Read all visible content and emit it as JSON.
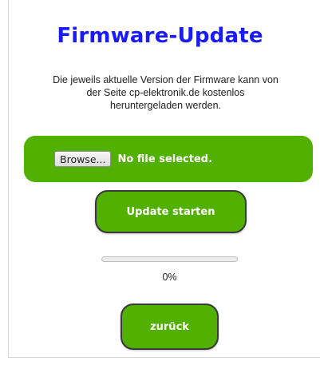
{
  "page": {
    "title": "Firmware-Update",
    "description_lines": [
      "Die jeweils aktuelle Version der Firmware kann von",
      "der Seite cp-elektronik.de kostenlos",
      "heruntergeladen werden."
    ]
  },
  "file_input": {
    "browse_label": "Browse...",
    "status_text": "No file selected."
  },
  "buttons": {
    "update_label": "Update starten",
    "back_label": "zurück"
  },
  "progress": {
    "value_percent": 0,
    "label": "0%"
  },
  "colors": {
    "title": "#1a1aff",
    "accent_green": "#52b000",
    "button_border": "#3a3a3a"
  }
}
